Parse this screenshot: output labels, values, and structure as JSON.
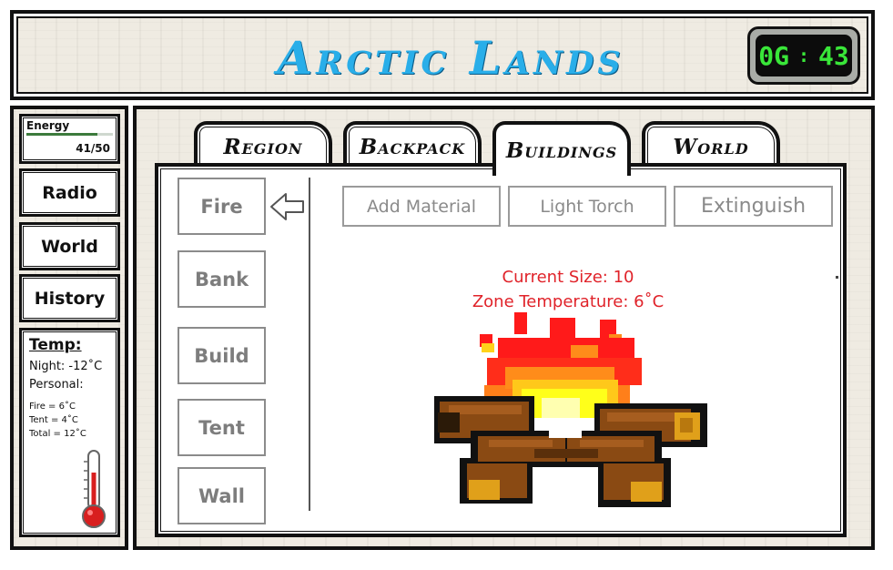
{
  "header": {
    "title": "Arctic Lands"
  },
  "clock": {
    "left": "0G",
    "right": "43"
  },
  "sidebar": {
    "energy": {
      "label": "Energy",
      "value": "41/50",
      "fraction": 0.82
    },
    "buttons": {
      "radio": "Radio",
      "world": "World",
      "history": "History"
    },
    "temp": {
      "title": "Temp:",
      "night": "Night: -12˚C",
      "personal": "Personal:",
      "fire": "Fire = 6˚C",
      "tent": "Tent = 4˚C",
      "total": "Total = 12˚C"
    }
  },
  "tabs": {
    "region": "Region",
    "backpack": "Backpack",
    "buildings": "Buildings",
    "world": "World",
    "active": "Buildings"
  },
  "buildings": {
    "fire": "Fire",
    "bank": "Bank",
    "build": "Build",
    "tent": "Tent",
    "wall": "Wall",
    "selected": "Fire"
  },
  "actions": {
    "add_material": "Add Material",
    "light_torch": "Light Torch",
    "extinguish": "Extinguish"
  },
  "fire_status": {
    "size": "Current Size: 10",
    "zone_temperature": "Zone Temperature: 6˚C"
  },
  "colors": {
    "title": "#29aee9",
    "clock_digits": "#39e639",
    "status_text": "#e0232a"
  },
  "icons": {
    "selected_indicator": "arrow-left-icon",
    "thermometer": "thermometer-icon",
    "campfire": "campfire-icon"
  }
}
